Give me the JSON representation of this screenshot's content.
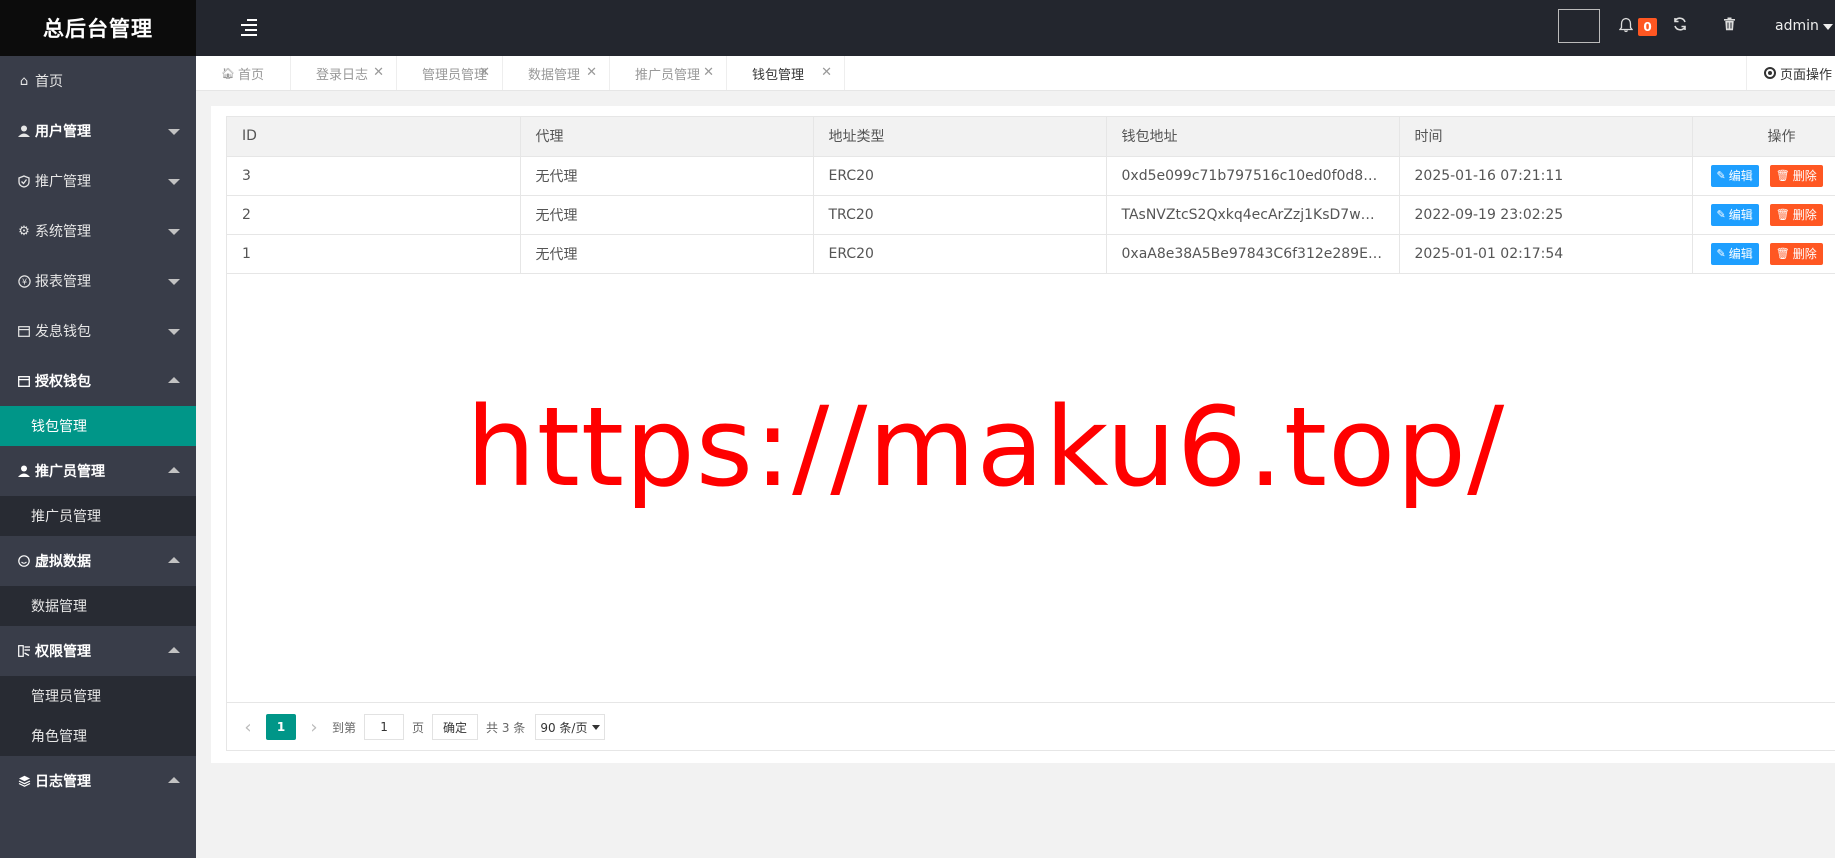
{
  "app": {
    "title": "总后台管理"
  },
  "sidebar": {
    "items": [
      {
        "label": "首页",
        "icon": "home-icon",
        "caret": ""
      },
      {
        "label": "用户管理",
        "icon": "user-icon",
        "caret": "down"
      },
      {
        "label": "推广管理",
        "icon": "shield-icon",
        "caret": "down"
      },
      {
        "label": "系统管理",
        "icon": "gear-icon",
        "caret": "down"
      },
      {
        "label": "报表管理",
        "icon": "yen-icon",
        "caret": "down"
      },
      {
        "label": "发息钱包",
        "icon": "wallet-icon",
        "caret": "down"
      },
      {
        "label": "授权钱包",
        "icon": "wallet-icon",
        "caret": "up",
        "sub": [
          {
            "label": "钱包管理",
            "active": true
          }
        ]
      },
      {
        "label": "推广员管理",
        "icon": "user-icon",
        "caret": "up",
        "sub": [
          {
            "label": "推广员管理"
          }
        ]
      },
      {
        "label": "虚拟数据",
        "icon": "smile-icon",
        "caret": "up",
        "sub": [
          {
            "label": "数据管理"
          }
        ]
      },
      {
        "label": "权限管理",
        "icon": "key-icon",
        "caret": "up",
        "sub": [
          {
            "label": "管理员管理"
          },
          {
            "label": "角色管理"
          }
        ]
      },
      {
        "label": "日志管理",
        "icon": "layers-icon",
        "caret": "up"
      }
    ]
  },
  "header": {
    "notification_count": "0",
    "user": "admin"
  },
  "tabs": [
    {
      "label": "首页",
      "closable": false,
      "active": false
    },
    {
      "label": "登录日志",
      "closable": true,
      "active": false
    },
    {
      "label": "管理员管理",
      "closable": true,
      "active": false
    },
    {
      "label": "数据管理",
      "closable": true,
      "active": false
    },
    {
      "label": "推广员管理",
      "closable": true,
      "active": false
    },
    {
      "label": "钱包管理",
      "closable": true,
      "active": true
    }
  ],
  "page_op": "页面操作",
  "table": {
    "columns": [
      "ID",
      "代理",
      "地址类型",
      "钱包地址",
      "时间",
      "操作"
    ],
    "rows": [
      {
        "id": "3",
        "agent": "无代理",
        "type": "ERC20",
        "address": "0xd5e099c71b797516c10ed0f0d895f42...",
        "time": "2025-01-16 07:21:11"
      },
      {
        "id": "2",
        "agent": "无代理",
        "type": "TRC20",
        "address": "TAsNVZtcS2Qxkq4ecArZzj1KsD7wZM...",
        "time": "2022-09-19 23:02:25"
      },
      {
        "id": "1",
        "agent": "无代理",
        "type": "ERC20",
        "address": "0xaA8e38A5Be97843C6f312e289EfCE...",
        "time": "2025-01-01 02:17:54"
      }
    ],
    "edit_label": "编辑",
    "delete_label": "删除"
  },
  "pager": {
    "current": "1",
    "goto_label": "到第",
    "goto_value": "1",
    "page_label": "页",
    "confirm_label": "确定",
    "total_label": "共 3 条",
    "page_size": "90 条/页"
  },
  "watermark": "https://maku6.top/",
  "colors": {
    "accent": "#009688",
    "sidebar": "#393d49",
    "header": "#23262e",
    "edit": "#1e9fff",
    "delete": "#ff5722"
  }
}
